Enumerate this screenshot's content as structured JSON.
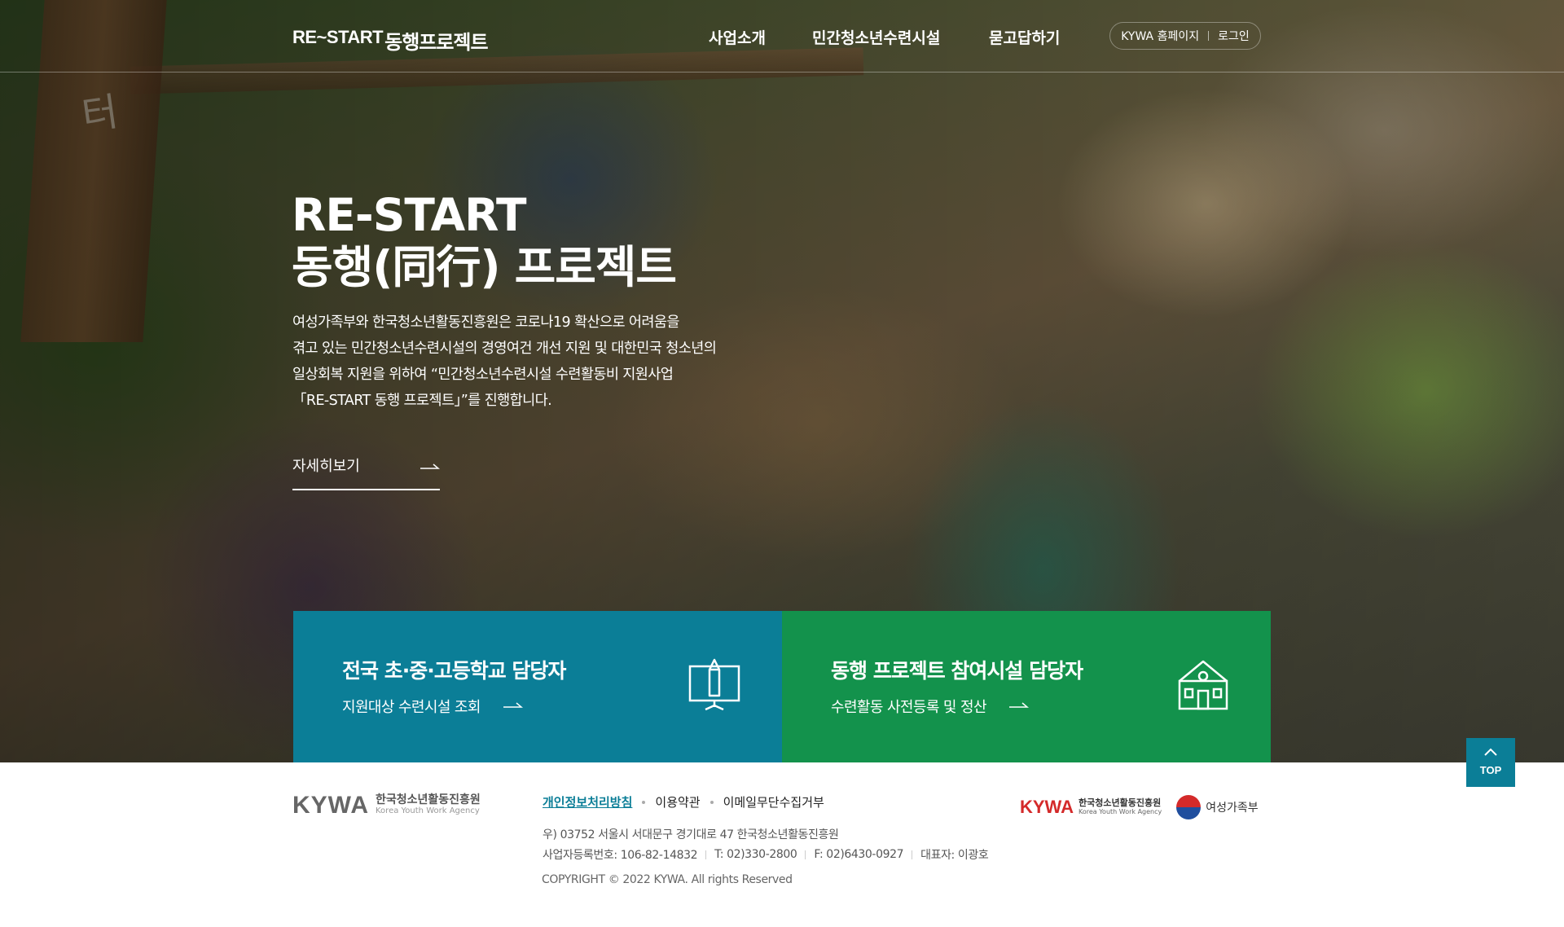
{
  "header": {
    "logo_en": "RE~START",
    "logo_ko": "동행프로젝트",
    "nav": [
      "사업소개",
      "민간청소년수련시설",
      "묻고답하기"
    ],
    "util_home": "KYWA 홈페이지",
    "util_login": "로그인"
  },
  "hero": {
    "title_line1": "RE-START",
    "title_line2": "동행(同行) 프로젝트",
    "desc_line1": "여성가족부와 한국청소년활동진흥원은 코로나19 확산으로 어려움을",
    "desc_line2": "겪고 있는 민간청소년수련시설의 경영여건 개선 지원 및 대한민국 청소년의",
    "desc_line3": "일상회복 지원을 위하여 “민간청소년수련시설 수련활동비 지원사업",
    "desc_line4": "「RE-START 동행 프로젝트」”를 진행합니다.",
    "more_label": "자세히보기"
  },
  "cards": [
    {
      "title": "전국 초·중·고등학교 담당자",
      "sub": "지원대상 수련시설 조회",
      "color": "#0b7e97",
      "icon": "monitor-pencil-icon"
    },
    {
      "title": "동행 프로젝트 참여시설 담당자",
      "sub": "수련활동 사전등록 및 정산",
      "color": "#13924c",
      "icon": "building-icon"
    }
  ],
  "top_button": "TOP",
  "footer": {
    "logo_word": "KYWA",
    "logo_ko": "한국청소년활동진흥원",
    "logo_en": "Korea Youth Work Agency",
    "links": [
      "개인정보처리방침",
      "이용약관",
      "이메일무단수집거부"
    ],
    "address": "우) 03752 서울시 서대문구 경기대로 47 한국청소년활동진흥원",
    "biz_no": "사업자등록번호: 106-82-14832",
    "tel": "T: 02)330-2800",
    "fax": "F: 02)6430-0927",
    "ceo": "대표자: 이광호",
    "copyright": "COPYRIGHT © 2022 KYWA. All rights Reserved",
    "partner_word": "KYWA",
    "partner_ko": "한국청소년활동진흥원",
    "partner_en": "Korea Youth Work Agency",
    "ministry": "여성가족부",
    "accent": "#0b7e97"
  }
}
